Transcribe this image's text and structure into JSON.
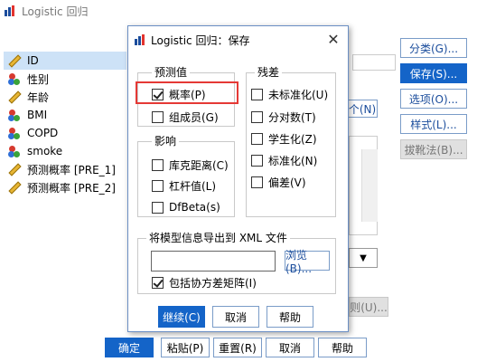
{
  "main_window": {
    "title": "Logistic 回归",
    "variables": [
      {
        "label": "ID",
        "icon": "ruler-icon",
        "selected": true
      },
      {
        "label": "性别",
        "icon": "nominal-icon"
      },
      {
        "label": "年龄",
        "icon": "ruler-icon"
      },
      {
        "label": "BMI",
        "icon": "nominal-icon"
      },
      {
        "label": "COPD",
        "icon": "nominal-icon"
      },
      {
        "label": "smoke",
        "icon": "nominal-icon"
      },
      {
        "label": "预测概率 [PRE_1]",
        "icon": "ruler-icon"
      },
      {
        "label": "预测概率 [PRE_2]",
        "icon": "ruler-icon"
      }
    ],
    "right_buttons": {
      "categorical": "分类(G)...",
      "save": "保存(S)...",
      "options": "选项(O)...",
      "style": "样式(L)...",
      "bootstrap": "拔靴法(B)..."
    },
    "partial_labels": {
      "next": "个(N)",
      "selection": "则(U)..."
    },
    "bottom_buttons": {
      "ok": "确定",
      "paste": "粘贴(P)",
      "reset": "重置(R)",
      "cancel": "取消",
      "help": "帮助"
    }
  },
  "save_dialog": {
    "title": "Logistic 回归：保存",
    "predicted_group": {
      "label": "预测值",
      "probability": {
        "text": "概率(P)",
        "checked": true
      },
      "membership": {
        "text": "组成员(G)",
        "checked": false
      }
    },
    "influence_group": {
      "label": "影响",
      "cooks": {
        "text": "库克距离(C)",
        "checked": false
      },
      "leverage": {
        "text": "杠杆值(L)",
        "checked": false
      },
      "dfbeta": {
        "text": "DfBeta(s)",
        "checked": false
      }
    },
    "residuals_group": {
      "label": "残差",
      "unstandardized": {
        "text": "未标准化(U)",
        "checked": false
      },
      "logit": {
        "text": "分对数(T)",
        "checked": false
      },
      "studentized": {
        "text": "学生化(Z)",
        "checked": false
      },
      "standardized": {
        "text": "标准化(N)",
        "checked": false
      },
      "deviance": {
        "text": "偏差(V)",
        "checked": false
      }
    },
    "export": {
      "label": "将模型信息导出到 XML 文件",
      "value": "",
      "browse": "浏览(B)...",
      "include_covariance": {
        "text": "包括协方差矩阵(I)",
        "checked": true
      }
    },
    "buttons": {
      "continue": "继续(C)",
      "cancel": "取消",
      "help": "帮助"
    }
  },
  "colors": {
    "accent": "#1464c8",
    "highlight": "#e53935",
    "selected_row": "#cde2f7"
  }
}
